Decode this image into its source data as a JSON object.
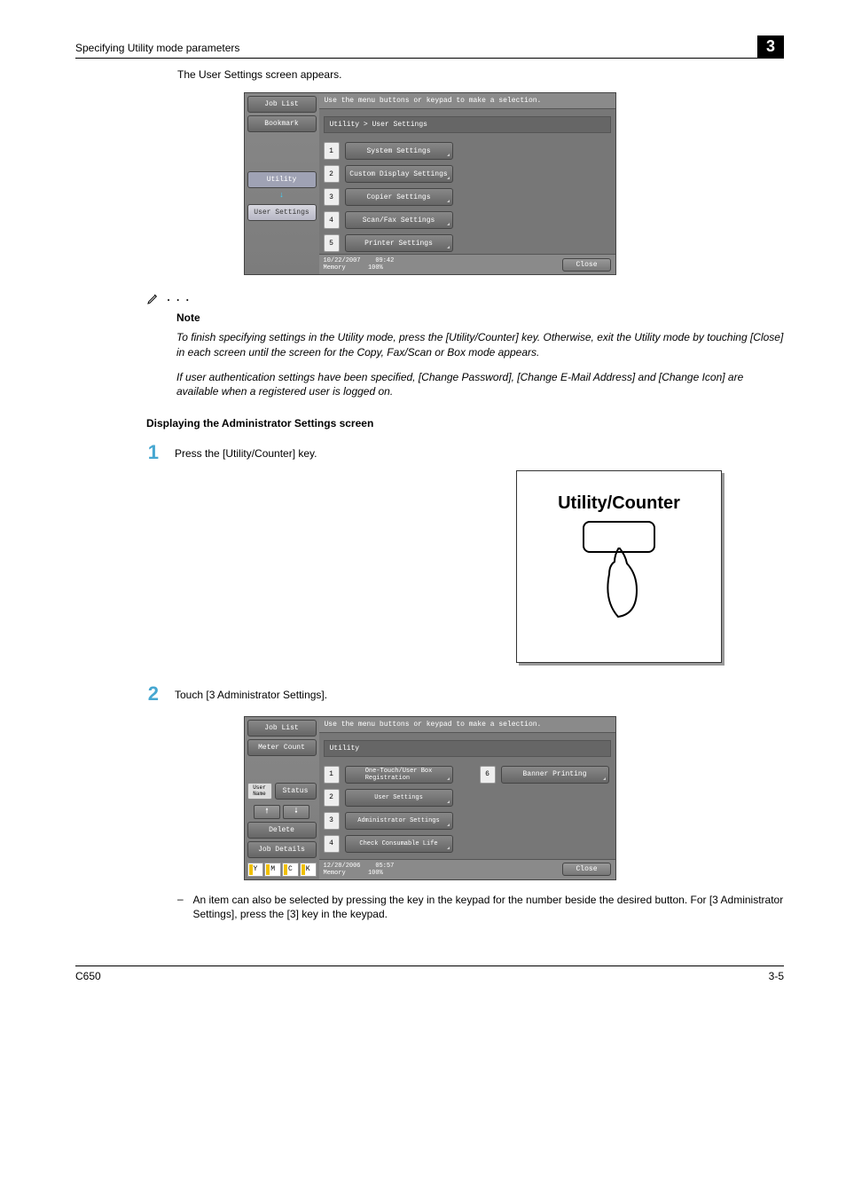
{
  "header": {
    "title": "Specifying Utility mode parameters",
    "chapter": "3"
  },
  "intro": "The User Settings screen appears.",
  "panel1": {
    "instruction": "Use the menu buttons or keypad to make a selection.",
    "breadcrumb": "Utility > User Settings",
    "side": {
      "job_list": "Job List",
      "bookmark": "Bookmark",
      "utility": "Utility",
      "user_settings": "User Settings"
    },
    "items": [
      {
        "n": "1",
        "label": "System Settings"
      },
      {
        "n": "2",
        "label": "Custom Display Settings"
      },
      {
        "n": "3",
        "label": "Copier Settings"
      },
      {
        "n": "4",
        "label": "Scan/Fax Settings"
      },
      {
        "n": "5",
        "label": "Printer Settings"
      }
    ],
    "footer": {
      "date": "10/22/2007",
      "time": "09:42",
      "mem_label": "Memory",
      "mem_val": "100%",
      "close": "Close"
    }
  },
  "note": {
    "heading": "Note",
    "p1": "To finish specifying settings in the Utility mode, press the [Utility/Counter] key. Otherwise, exit the Utility mode by touching [Close] in each screen until the screen for the Copy, Fax/Scan or Box mode appears.",
    "p2": "If user authentication settings have been specified, [Change Password], [Change E-Mail Address] and [Change Icon] are available when a registered user is logged on."
  },
  "section_heading": "Displaying the Administrator Settings screen",
  "steps": {
    "s1": "Press the [Utility/Counter] key.",
    "s2": "Touch [3 Administrator Settings].",
    "key_label": "Utility/Counter",
    "dash_note": "An item can also be selected by pressing the key in the keypad for the number beside the desired button. For [3 Administrator Settings], press the [3] key in the keypad."
  },
  "panel2": {
    "instruction": "Use the menu buttons or keypad to make a selection.",
    "breadcrumb": "Utility",
    "side": {
      "job_list": "Job List",
      "meter": "Meter Count",
      "user_name": "User\nName",
      "status": "Status",
      "delete": "Delete",
      "job_details": "Job Details"
    },
    "items_left": [
      {
        "n": "1",
        "label": "One-Touch/User Box\nRegistration"
      },
      {
        "n": "2",
        "label": "User Settings"
      },
      {
        "n": "3",
        "label": "Administrator Settings"
      },
      {
        "n": "4",
        "label": "Check Consumable Life"
      }
    ],
    "items_right": [
      {
        "n": "6",
        "label": "Banner Printing"
      }
    ],
    "status_letters": [
      "Y",
      "M",
      "C",
      "K"
    ],
    "footer": {
      "date": "12/28/2006",
      "time": "05:57",
      "mem_label": "Memory",
      "mem_val": "100%",
      "close": "Close"
    }
  },
  "footer": {
    "left": "C650",
    "right": "3-5"
  }
}
